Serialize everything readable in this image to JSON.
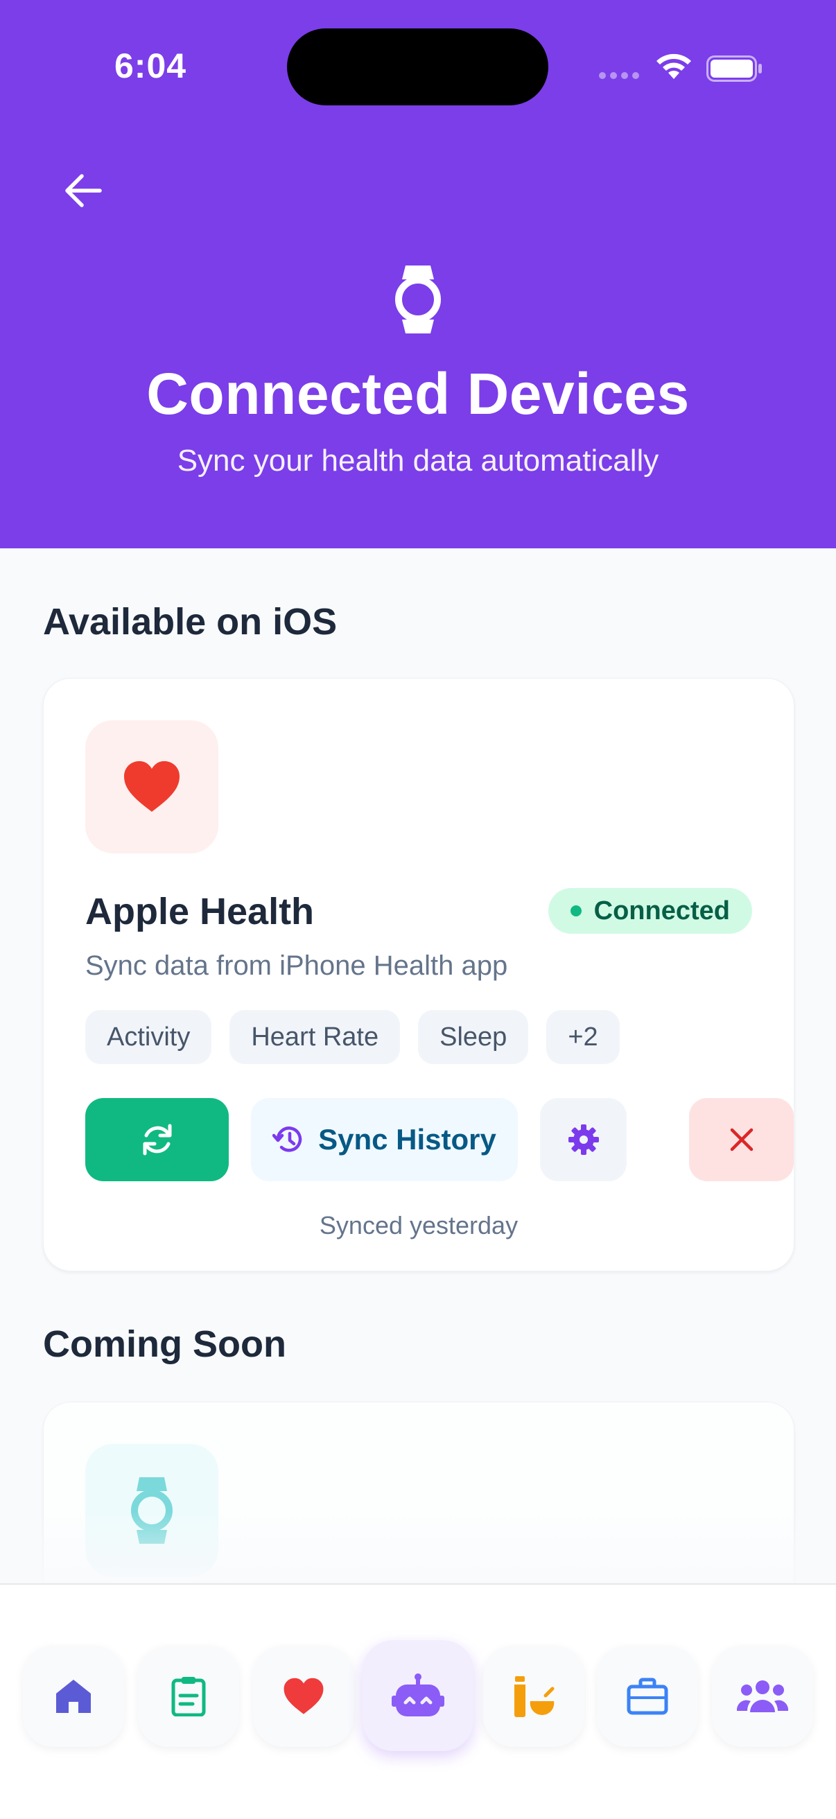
{
  "status_bar": {
    "time": "6:04"
  },
  "header": {
    "title": "Connected Devices",
    "subtitle": "Sync your health data automatically"
  },
  "available_section": {
    "title": "Available on iOS"
  },
  "device_card": {
    "name": "Apple Health",
    "status": "Connected",
    "description": "Sync data from iPhone Health app",
    "tags": [
      "Activity",
      "Heart Rate",
      "Sleep",
      "+2"
    ],
    "sync_history_label": "Sync History",
    "sync_note": "Synced yesterday"
  },
  "coming_section": {
    "title": "Coming Soon"
  },
  "bottom_nav": {
    "items": [
      "home-icon",
      "clipboard-icon",
      "heart-icon",
      "robot-icon",
      "bottle-icon",
      "briefcase-icon",
      "users-icon"
    ],
    "active": "robot-icon"
  },
  "colors": {
    "header": "#7b3ee9",
    "connected_badge": "#d1fae5",
    "sync_button": "#10b981",
    "disconnect_button": "#fee2e2"
  }
}
